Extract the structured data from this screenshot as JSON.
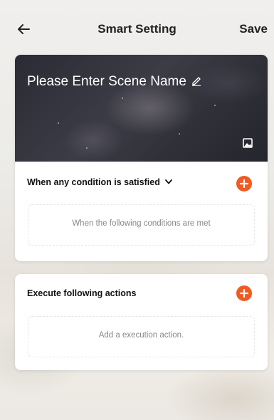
{
  "header": {
    "title": "Smart Setting",
    "save_label": "Save"
  },
  "scene": {
    "name_placeholder": "Please Enter Scene Name"
  },
  "conditions": {
    "title": "When any condition is satisfied",
    "empty_text": "When the following conditions are met"
  },
  "actions": {
    "title": "Execute following actions",
    "empty_text": "Add a execution action."
  },
  "colors": {
    "accent": "#f15a22",
    "banner": "#2a2b34"
  },
  "icons": {
    "back": "arrow-left-icon",
    "edit": "pencil-icon",
    "image": "image-icon",
    "chevron": "chevron-down-icon",
    "add": "plus-icon"
  }
}
